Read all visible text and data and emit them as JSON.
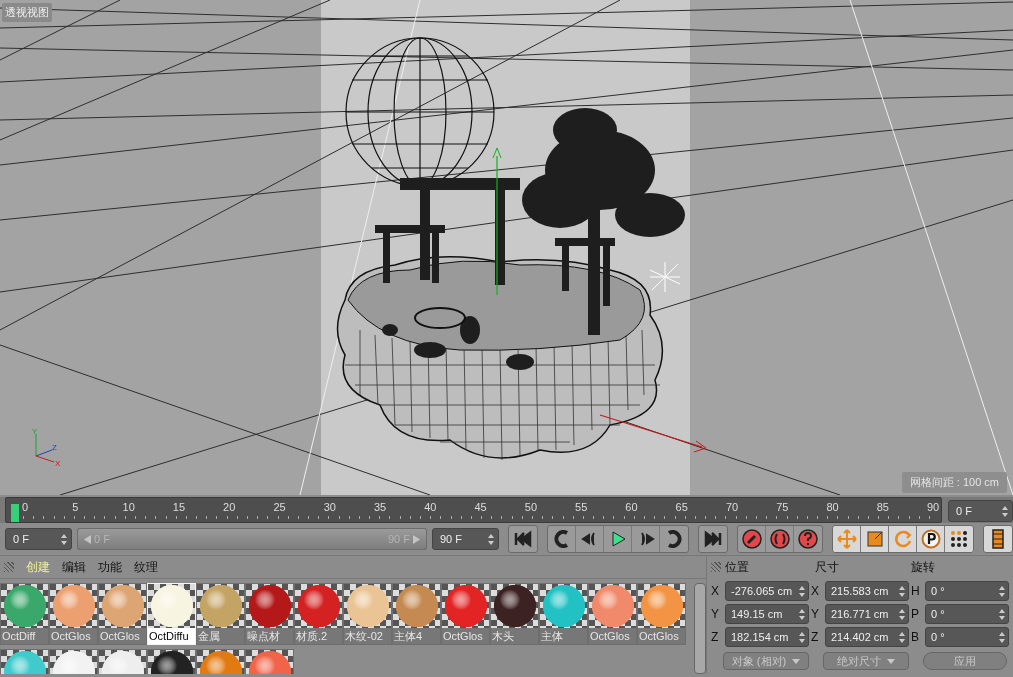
{
  "viewport": {
    "title": "透视视图",
    "grid_spacing": "网格间距 : 100 cm",
    "gizmo_axes": [
      "Y",
      "Z",
      "X"
    ]
  },
  "timeline": {
    "ticks": [
      "0",
      "5",
      "10",
      "15",
      "20",
      "25",
      "30",
      "35",
      "40",
      "45",
      "50",
      "55",
      "60",
      "65",
      "70",
      "75",
      "80",
      "85",
      "90"
    ],
    "playhead": {
      "level": 0
    },
    "current_frame": "0 F"
  },
  "playback": {
    "start_field": "0 F",
    "range": {
      "start": "0 F",
      "end": "90 F",
      "level": 1
    },
    "end_field": "90 F"
  },
  "material_manager": {
    "menu": [
      {
        "label": "创建",
        "selected": true
      },
      {
        "label": "编辑",
        "selected": false
      },
      {
        "label": "功能",
        "selected": false
      },
      {
        "label": "纹理",
        "selected": false
      }
    ],
    "materials": [
      {
        "name": "OctDiff",
        "color": "#3aa86a",
        "selected": false
      },
      {
        "name": "OctGlos",
        "color": "#eca070",
        "selected": false
      },
      {
        "name": "OctGlos",
        "color": "#dea574",
        "selected": false
      },
      {
        "name": "OctDiffu",
        "color": "#f7f4e2",
        "selected": true
      },
      {
        "name": "金属",
        "color": "#c4a464",
        "selected": false
      },
      {
        "name": "噪点材",
        "color": "#b41818",
        "selected": false
      },
      {
        "name": "材质.2",
        "color": "#d42222",
        "selected": false
      },
      {
        "name": "木纹-02",
        "color": "#eac494",
        "selected": false
      },
      {
        "name": "主体4",
        "color": "#c48a52",
        "selected": false
      },
      {
        "name": "OctGlos",
        "color": "#e22424",
        "selected": false
      },
      {
        "name": "木头",
        "color": "#3c2222",
        "selected": false
      },
      {
        "name": "主体",
        "color": "#22c2c4",
        "selected": false
      },
      {
        "name": "OctGlos",
        "color": "#f08a6a",
        "selected": false
      },
      {
        "name": "OctGlos",
        "color": "#f29444",
        "selected": false
      },
      {
        "color": "#40cacc",
        "selected": false
      },
      {
        "color": "#f2f2f2",
        "selected": false
      },
      {
        "color": "#eeeeee",
        "selected": false
      },
      {
        "color": "#222222",
        "selected": false
      },
      {
        "color": "#e27a12",
        "selected": false
      },
      {
        "color": "#f2644a",
        "selected": false
      }
    ]
  },
  "coordinates": {
    "headers": [
      "位置",
      "尺寸",
      "旋转"
    ],
    "rows": [
      {
        "position_axis": "X",
        "position": "-276.065 cm",
        "size_axis": "X",
        "size": "215.583 cm",
        "rotation_axis": "H",
        "rotation": "0 °"
      },
      {
        "position_axis": "Y",
        "position": "149.15 cm",
        "size_axis": "Y",
        "size": "216.771 cm",
        "rotation_axis": "P",
        "rotation": "0 °"
      },
      {
        "position_axis": "Z",
        "position": "182.154 cm",
        "size_axis": "Z",
        "size": "214.402 cm",
        "rotation_axis": "B",
        "rotation": "0 °"
      }
    ],
    "mode_dropdown": "对象 (相对)",
    "size_dropdown": "绝对尺寸",
    "apply_button": "应用"
  }
}
